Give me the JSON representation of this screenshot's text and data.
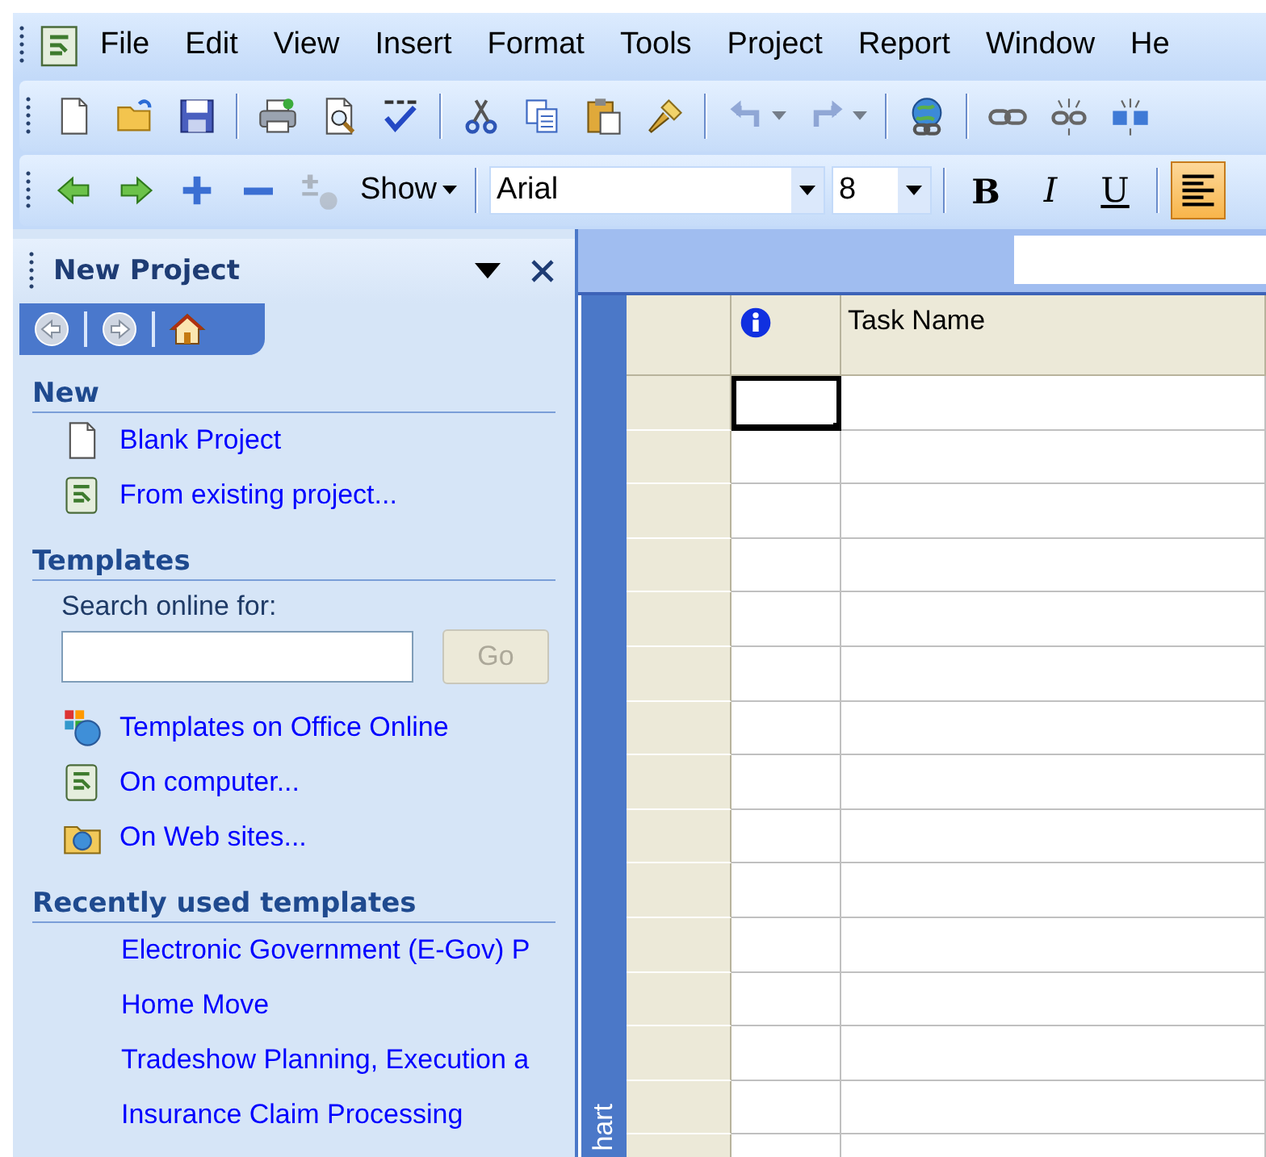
{
  "menu_bar": {
    "items": [
      "File",
      "Edit",
      "View",
      "Insert",
      "Format",
      "Tools",
      "Project",
      "Report",
      "Window",
      "He"
    ]
  },
  "standard_toolbar": {
    "groups": [
      [
        {
          "kind": "new",
          "disabled": false
        },
        {
          "kind": "open",
          "disabled": false
        },
        {
          "kind": "save",
          "disabled": false
        }
      ],
      [
        {
          "kind": "print",
          "disabled": false
        },
        {
          "kind": "preview",
          "disabled": false
        },
        {
          "kind": "spelling",
          "disabled": false
        }
      ],
      [
        {
          "kind": "cut",
          "disabled": false
        },
        {
          "kind": "copy",
          "disabled": false
        },
        {
          "kind": "paste",
          "disabled": false
        },
        {
          "kind": "painter",
          "disabled": false
        }
      ],
      [
        {
          "kind": "undo",
          "disabled": true
        },
        {
          "kind": "redo",
          "disabled": true
        }
      ],
      [
        {
          "kind": "hyperlink",
          "disabled": false
        }
      ],
      [
        {
          "kind": "link",
          "disabled": false
        },
        {
          "kind": "unlink",
          "disabled": false
        },
        {
          "kind": "split",
          "disabled": false
        }
      ]
    ]
  },
  "formatting_toolbar": {
    "outline_buttons": [
      {
        "kind": "outdent",
        "disabled": false
      },
      {
        "kind": "indent",
        "disabled": false
      },
      {
        "kind": "expand",
        "disabled": false
      },
      {
        "kind": "collapse",
        "disabled": false
      },
      {
        "kind": "outline",
        "disabled": true
      }
    ],
    "show_menu": {
      "label": "Show"
    },
    "font": {
      "value": "Arial"
    },
    "font_size": {
      "value": "8"
    },
    "format_buttons": [
      {
        "kind": "bold",
        "label": "B",
        "on": false
      },
      {
        "kind": "italic",
        "label": "I",
        "on": false
      },
      {
        "kind": "underline",
        "label": "U",
        "on": false
      }
    ],
    "align_buttons": [
      {
        "kind": "align",
        "on": true
      }
    ]
  },
  "task_pane": {
    "title": "New Project",
    "sections": [
      {
        "heading": "New",
        "items": [
          {
            "kind": "document",
            "label": "Blank Project"
          },
          {
            "kind": "project",
            "label": "From existing project..."
          }
        ]
      },
      {
        "heading": "Templates",
        "search": {
          "label": "Search online for:",
          "button": {
            "label": "Go",
            "disabled": true
          }
        },
        "items": [
          {
            "kind": "online",
            "label": "Templates on Office Online"
          },
          {
            "kind": "project",
            "label": "On computer..."
          },
          {
            "kind": "web",
            "label": "On Web sites..."
          }
        ]
      },
      {
        "heading": "Recently used templates",
        "items": [
          {
            "kind": "recent",
            "label": "Electronic Government (E-Gov) P"
          },
          {
            "kind": "recent",
            "label": "Home Move"
          },
          {
            "kind": "recent",
            "label": "Tradeshow Planning, Execution a"
          },
          {
            "kind": "recent",
            "label": "Insurance Claim Processing"
          }
        ]
      }
    ]
  },
  "view_bar": {
    "label": "hart"
  },
  "table": {
    "columns": [
      {
        "kind": "indicators"
      },
      {
        "kind": "text",
        "label": "Task Name"
      }
    ],
    "rows": [
      {
        "selected": true
      },
      {
        "selected": false
      },
      {
        "selected": false
      },
      {
        "selected": false
      },
      {
        "selected": false
      },
      {
        "selected": false
      },
      {
        "selected": false
      },
      {
        "selected": false
      },
      {
        "selected": false
      },
      {
        "selected": false
      },
      {
        "selected": false
      },
      {
        "selected": false
      },
      {
        "selected": false
      },
      {
        "selected": false
      },
      {
        "selected": false
      }
    ]
  }
}
